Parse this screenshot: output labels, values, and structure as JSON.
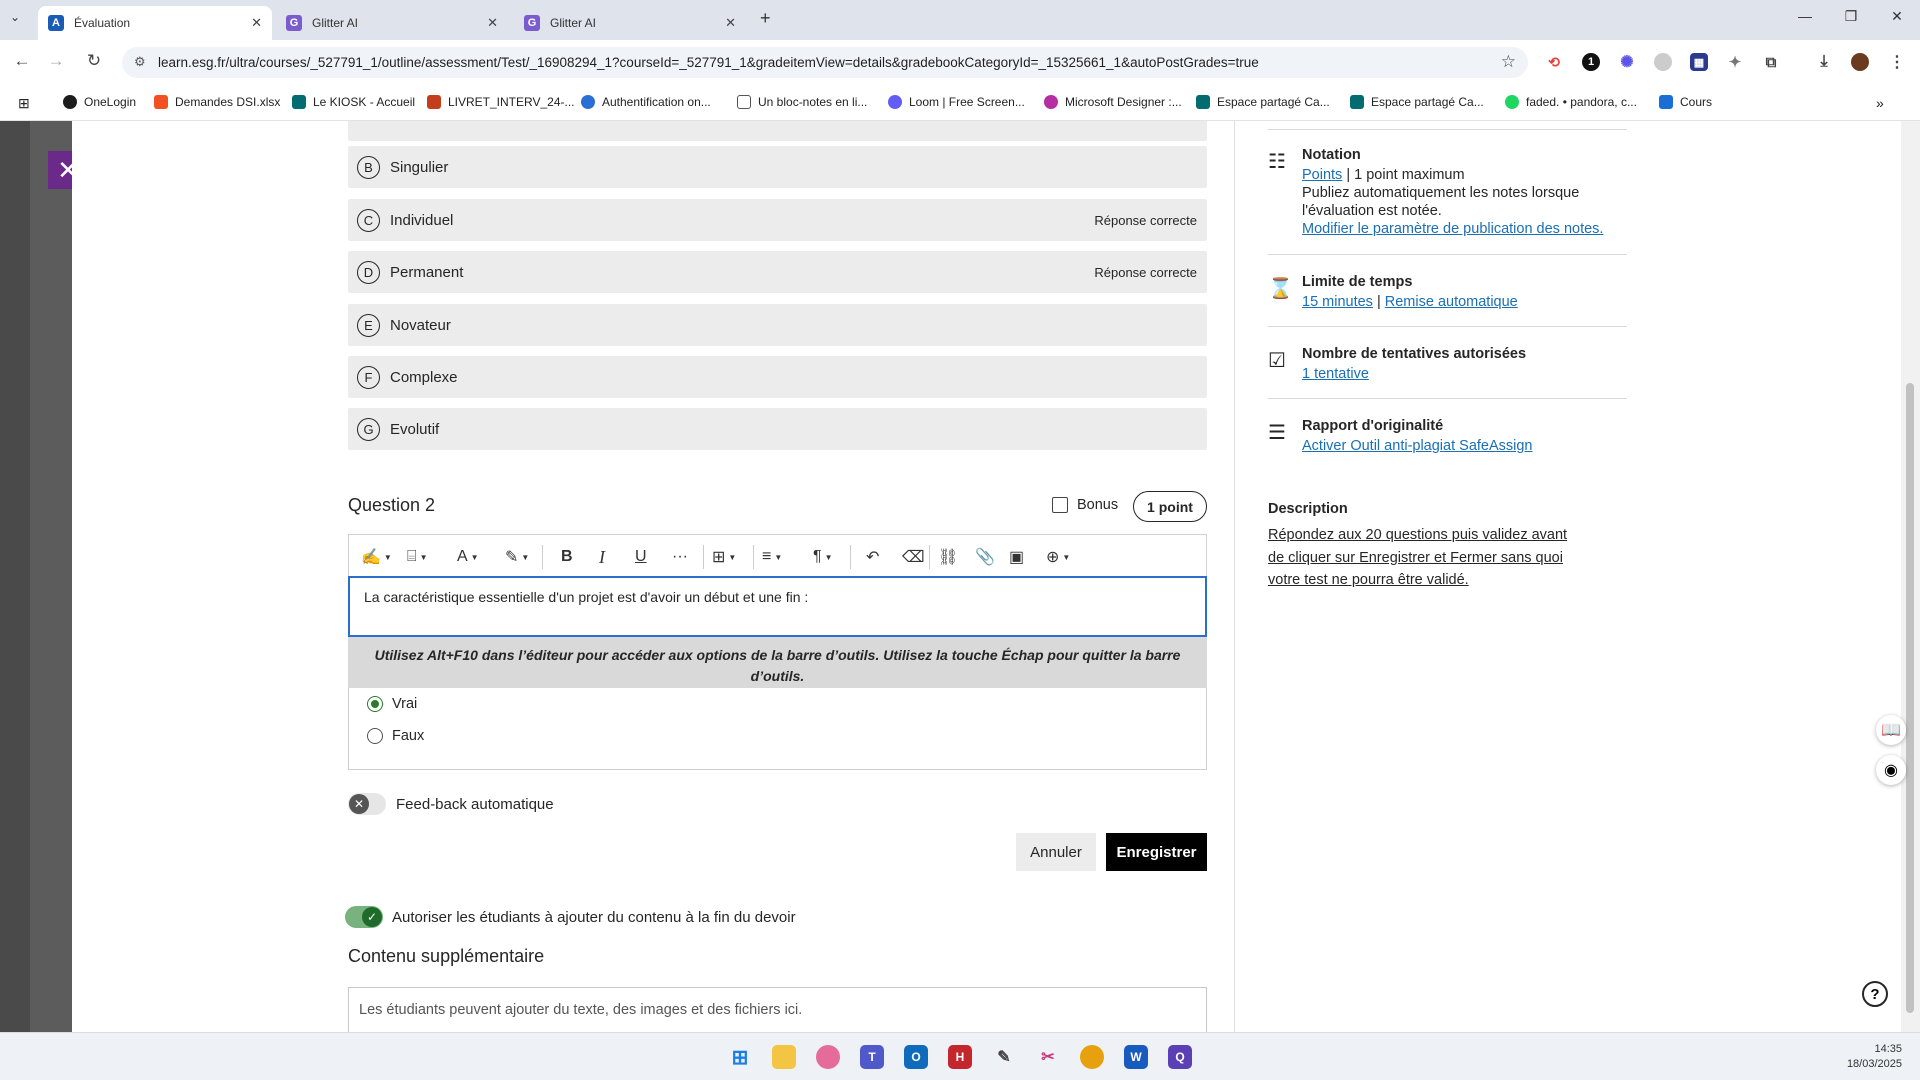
{
  "browser": {
    "tabs": [
      {
        "title": "Évaluation",
        "icon": "blackboard-icon",
        "active": true
      },
      {
        "title": "Glitter AI",
        "icon": "glitter-icon",
        "active": false
      },
      {
        "title": "Glitter AI",
        "icon": "glitter-icon",
        "active": false
      }
    ],
    "url": "learn.esg.fr/ultra/courses/_527791_1/outline/assessment/Test/_16908294_1?courseId=_527791_1&gradeitemView=details&gradebookCategoryId=_15325661_1&autoPostGrades=true",
    "bookmarks": [
      {
        "label": "OneLogin",
        "color": "#1c1c1c"
      },
      {
        "label": "Demandes DSI.xlsx",
        "color": "#f25022"
      },
      {
        "label": "Le KIOSK - Accueil",
        "color": "#036c70"
      },
      {
        "label": "LIVRET_INTERV_24-...",
        "color": "#c43e1c"
      },
      {
        "label": "Authentification on...",
        "color": "#2a6fd6"
      },
      {
        "label": "Un bloc-notes en li...",
        "color": "#555555"
      },
      {
        "label": "Loom | Free Screen...",
        "color": "#625df5"
      },
      {
        "label": "Microsoft Designer :...",
        "color": "#b52ea3"
      },
      {
        "label": "Espace partagé Ca...",
        "color": "#036c70"
      },
      {
        "label": "Espace partagé Ca...",
        "color": "#036c70"
      },
      {
        "label": "faded. • pandora, c...",
        "color": "#1ed760"
      },
      {
        "label": "Cours",
        "color": "#1a6fd6"
      }
    ]
  },
  "question1": {
    "options": [
      {
        "letter": "B",
        "text": "Singulier",
        "correct_label": ""
      },
      {
        "letter": "C",
        "text": "Individuel",
        "correct_label": "Réponse correcte"
      },
      {
        "letter": "D",
        "text": "Permanent",
        "correct_label": "Réponse correcte"
      },
      {
        "letter": "E",
        "text": "Novateur",
        "correct_label": ""
      },
      {
        "letter": "F",
        "text": "Complexe",
        "correct_label": ""
      },
      {
        "letter": "G",
        "text": "Evolutif",
        "correct_label": ""
      }
    ]
  },
  "question2": {
    "title": "Question 2",
    "bonus_label": "Bonus",
    "points_label": "1 point",
    "editor_text": "La caractéristique essentielle d'un projet est d'avoir un début et une fin :",
    "hint": "Utilisez Alt+F10 dans l’éditeur pour accéder aux options de la barre d’outils. Utilisez la touche Échap pour quitter la barre d’outils.",
    "answers": [
      {
        "label": "Vrai",
        "selected": true
      },
      {
        "label": "Faux",
        "selected": false
      }
    ],
    "feedback_label": "Feed-back automatique",
    "cancel_label": "Annuler",
    "save_label": "Enregistrer"
  },
  "allow_label": "Autoriser les étudiants à ajouter du contenu à la fin du devoir",
  "extra": {
    "title": "Contenu supplémentaire",
    "placeholder": "Les étudiants peuvent ajouter du texte, des images et des fichiers ici."
  },
  "settings": {
    "notation_title": "Notation",
    "notation_link": "Points",
    "notation_max": "1 point maximum",
    "notation_desc_1": "Publiez automatiquement les notes lorsque",
    "notation_desc_2": "l'évaluation est notée.",
    "notation_modify": "Modifier le paramètre de publication des notes.",
    "time_title": "Limite de temps",
    "time_link": "15 minutes",
    "time_auto": "Remise automatique",
    "attempts_title": "Nombre de tentatives autorisées",
    "attempts_link": "1 tentative",
    "originality_title": "Rapport d'originalité",
    "originality_link": "Activer Outil anti-plagiat SafeAssign",
    "description_title": "Description",
    "description_text": "Répondez aux 20 questions puis validez avant de cliquer sur Enregistrer et Fermer sans quoi votre test ne pourra être validé."
  },
  "taskbar": {
    "time": "14:35",
    "date": "18/03/2025"
  }
}
